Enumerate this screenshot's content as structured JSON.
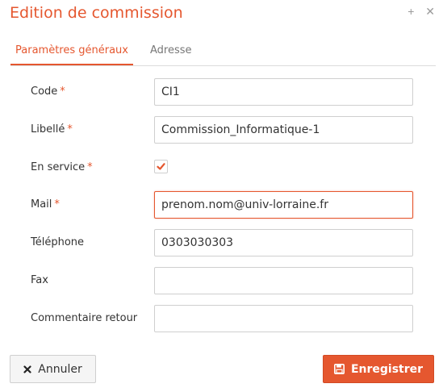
{
  "dialog": {
    "title": "Edition de commission",
    "icons": [
      "plus-icon",
      "close-icon"
    ]
  },
  "tabs": [
    {
      "label": "Paramètres généraux",
      "active": true
    },
    {
      "label": "Adresse",
      "active": false
    }
  ],
  "form": {
    "required_marker": "*",
    "code": {
      "label": "Code",
      "value": "CI1",
      "required": true
    },
    "libelle": {
      "label": "Libellé",
      "value": "Commission_Informatique-1",
      "required": true
    },
    "en_service": {
      "label": "En service",
      "checked": true,
      "required": true
    },
    "mail": {
      "label": "Mail",
      "value": "prenom.nom@univ-lorraine.fr",
      "required": true
    },
    "telephone": {
      "label": "Téléphone",
      "value": "0303030303",
      "required": false
    },
    "fax": {
      "label": "Fax",
      "value": "",
      "required": false
    },
    "commentaire": {
      "label": "Commentaire retour",
      "value": "",
      "required": false
    }
  },
  "buttons": {
    "cancel_label": "Annuler",
    "cancel_icon": "close-icon",
    "save_label": "Enregistrer",
    "save_icon": "floppy-disk-icon"
  },
  "colors": {
    "accent": "#e5572f",
    "border": "#cfcfcf"
  }
}
